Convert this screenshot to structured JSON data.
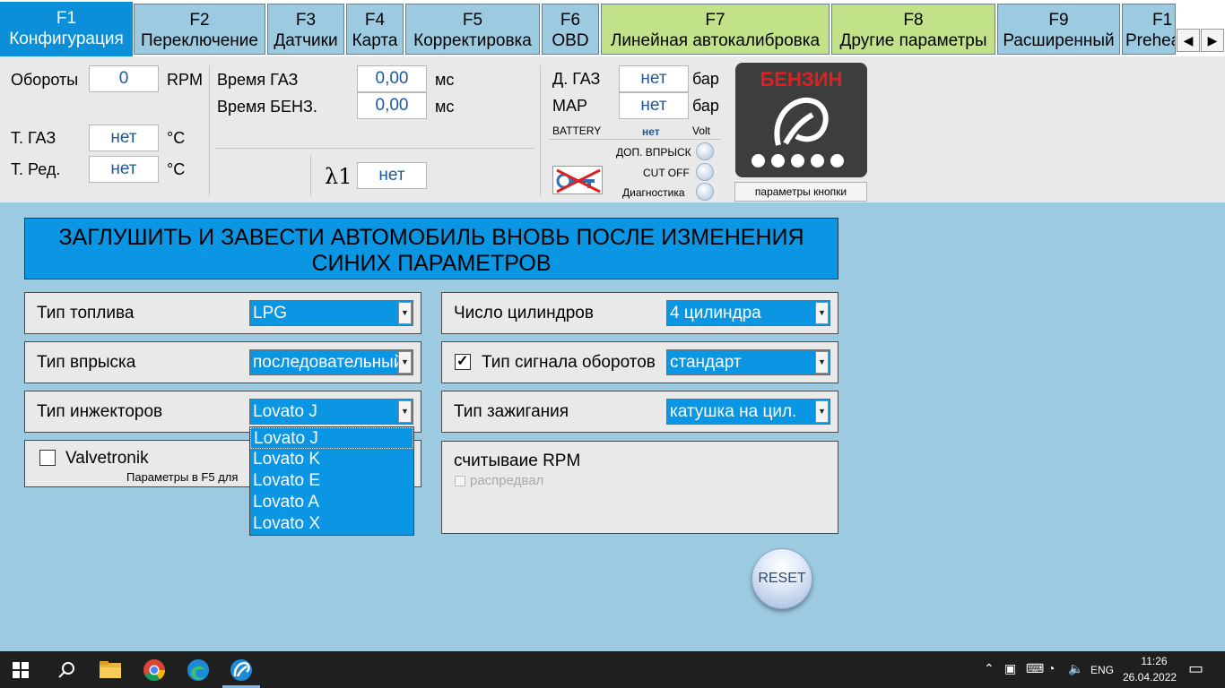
{
  "tabs": [
    {
      "key": "F1",
      "label": "Конфигурация"
    },
    {
      "key": "F2",
      "label": "Переключение"
    },
    {
      "key": "F3",
      "label": "Датчики"
    },
    {
      "key": "F4",
      "label": "Карта"
    },
    {
      "key": "F5",
      "label": "Корректировка"
    },
    {
      "key": "F6",
      "label": "OBD"
    },
    {
      "key": "F7",
      "label": "Линейная автокалибровка"
    },
    {
      "key": "F8",
      "label": "Другие параметры"
    },
    {
      "key": "F9",
      "label": "Расширенный"
    },
    {
      "key": "F1",
      "label": "Preheat"
    }
  ],
  "nav": {
    "prev": "◀",
    "next": "▶"
  },
  "status": {
    "rpm_label": "Обороты",
    "rpm_value": "0",
    "rpm_unit": "RPM",
    "tgas_label": "Т. ГАЗ",
    "tgas_value": "нет",
    "tgas_unit": "°C",
    "tred_label": "Т. Ред.",
    "tred_value": "нет",
    "tred_unit": "°C",
    "tgas_time_label": "Время ГАЗ",
    "tgas_time_value": "0,00",
    "tgas_time_unit": "мс",
    "tben_time_label": "Время БЕНЗ.",
    "tben_time_value": "0,00",
    "tben_time_unit": "мс",
    "lambda_label": "λ1",
    "lambda_value": "нет",
    "dgas_label": "Д. ГАЗ",
    "dgas_value": "нет",
    "dgas_unit": "бар",
    "map_label": "MAP",
    "map_value": "нет",
    "map_unit": "бар",
    "battery_label": "BATTERY",
    "battery_value": "нет",
    "battery_unit": "Volt",
    "led1": "ДОП. ВПРЫСК",
    "led2": "CUT OFF",
    "led3": "Диагностика",
    "benzin_title": "БЕНЗИН",
    "button_params": "параметры кнопки"
  },
  "banner": "ЗАГЛУШИТЬ И ЗАВЕСТИ АВТОМОБИЛЬ ВНОВЬ ПОСЛЕ ИЗМЕНЕНИЯ СИНИХ ПАРАМЕТРОВ",
  "config": {
    "fuel_label": "Тип топлива",
    "fuel_value": "LPG",
    "inj_type_label": "Тип впрыска",
    "inj_type_value": "последовательный",
    "injectors_label": "Тип инжекторов",
    "injectors_value": "Lovato J",
    "cylinders_label": "Число цилиндров",
    "cylinders_value": "4 цилиндра",
    "rpm_signal_label": "Тип сигнала оборотов",
    "rpm_signal_value": "стандарт",
    "ignition_label": "Тип зажигания",
    "ignition_value": "катушка на цил.",
    "valvetronik_label": "Valvetronik",
    "valvetronik_note": "Параметры в F5 для",
    "rpm_read_label": "считываие RPM",
    "distributor_label": "распредвал"
  },
  "dropdown_options": [
    "Lovato J",
    "Lovato K",
    "Lovato E",
    "Lovato A",
    "Lovato X"
  ],
  "reset_label": "RESET",
  "taskbar": {
    "lang": "ENG",
    "time": "11:26",
    "date": "26.04.2022"
  },
  "colors": {
    "accent": "#0a96e2",
    "active_tab": "#0a8fd8",
    "green_tab": "#c2e28a",
    "background": "#9ccae0"
  }
}
